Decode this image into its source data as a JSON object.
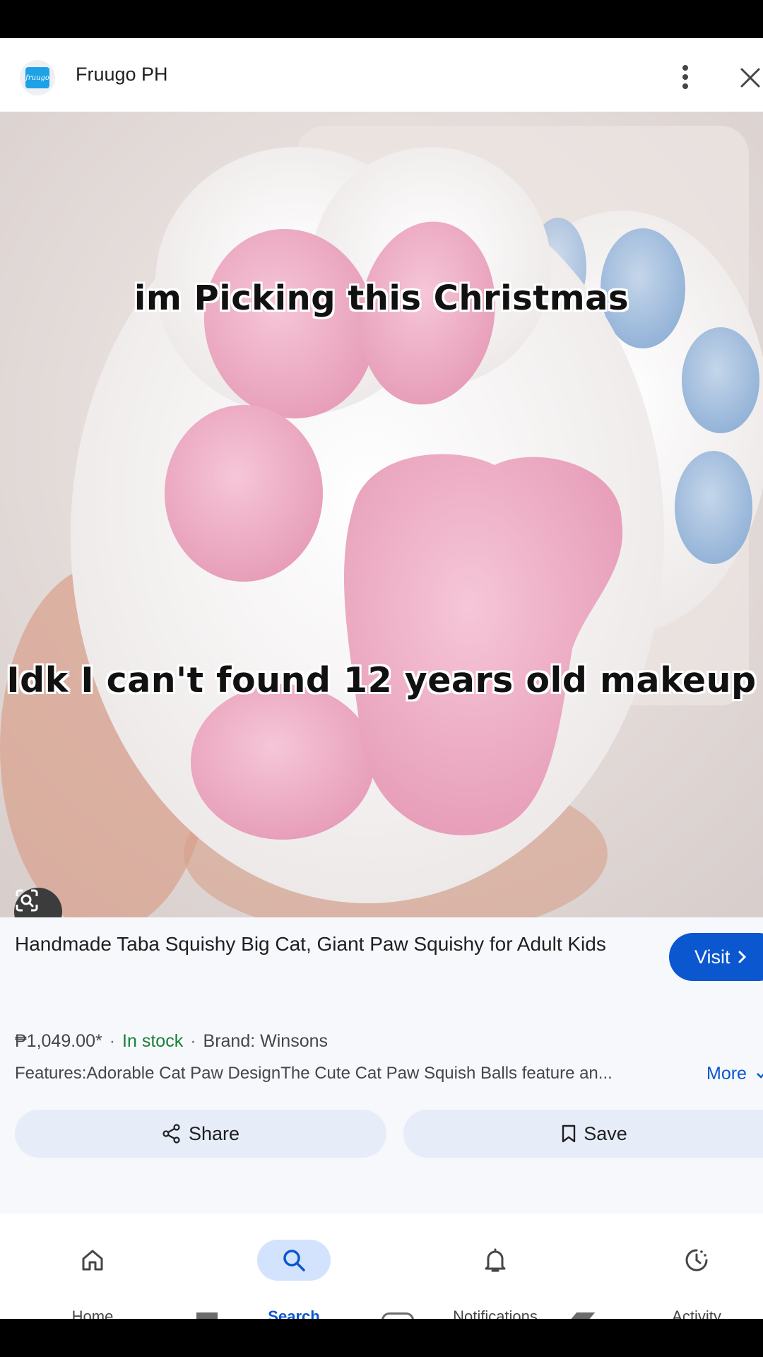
{
  "header": {
    "logo_text": "fruugo",
    "site_name": "Fruugo PH",
    "menu_icon": "more-vert-icon",
    "close_icon": "close-icon"
  },
  "image": {
    "caption_top": "im Picking this Christmas",
    "caption_bottom": "Idk I can't found 12 years old makeup",
    "lens_icon": "lens-search-icon"
  },
  "product": {
    "title": "Handmade Taba Squishy Big Cat, Giant Paw Squishy for Adult Kids",
    "price": "₱1,049.00*",
    "availability": "In stock",
    "brand": "Brand: Winsons",
    "features": "Features:Adorable Cat Paw DesignThe Cute Cat Paw Squish Balls feature an...",
    "more_label": "More"
  },
  "actions": {
    "visit_label": "Visit",
    "share_label": "Share",
    "save_label": "Save"
  },
  "nav": {
    "items": [
      {
        "label": "Home",
        "icon": "home-icon",
        "active": false
      },
      {
        "label": "Search",
        "icon": "search-icon",
        "active": true
      },
      {
        "label": "Notifications",
        "icon": "bell-icon",
        "active": false
      },
      {
        "label": "Activity",
        "icon": "activity-icon",
        "active": false
      }
    ]
  },
  "colors": {
    "accent": "#0b57d0",
    "in_stock": "#188038",
    "active_pill": "#d3e3fd",
    "action_button_bg": "#e6ecf8"
  }
}
